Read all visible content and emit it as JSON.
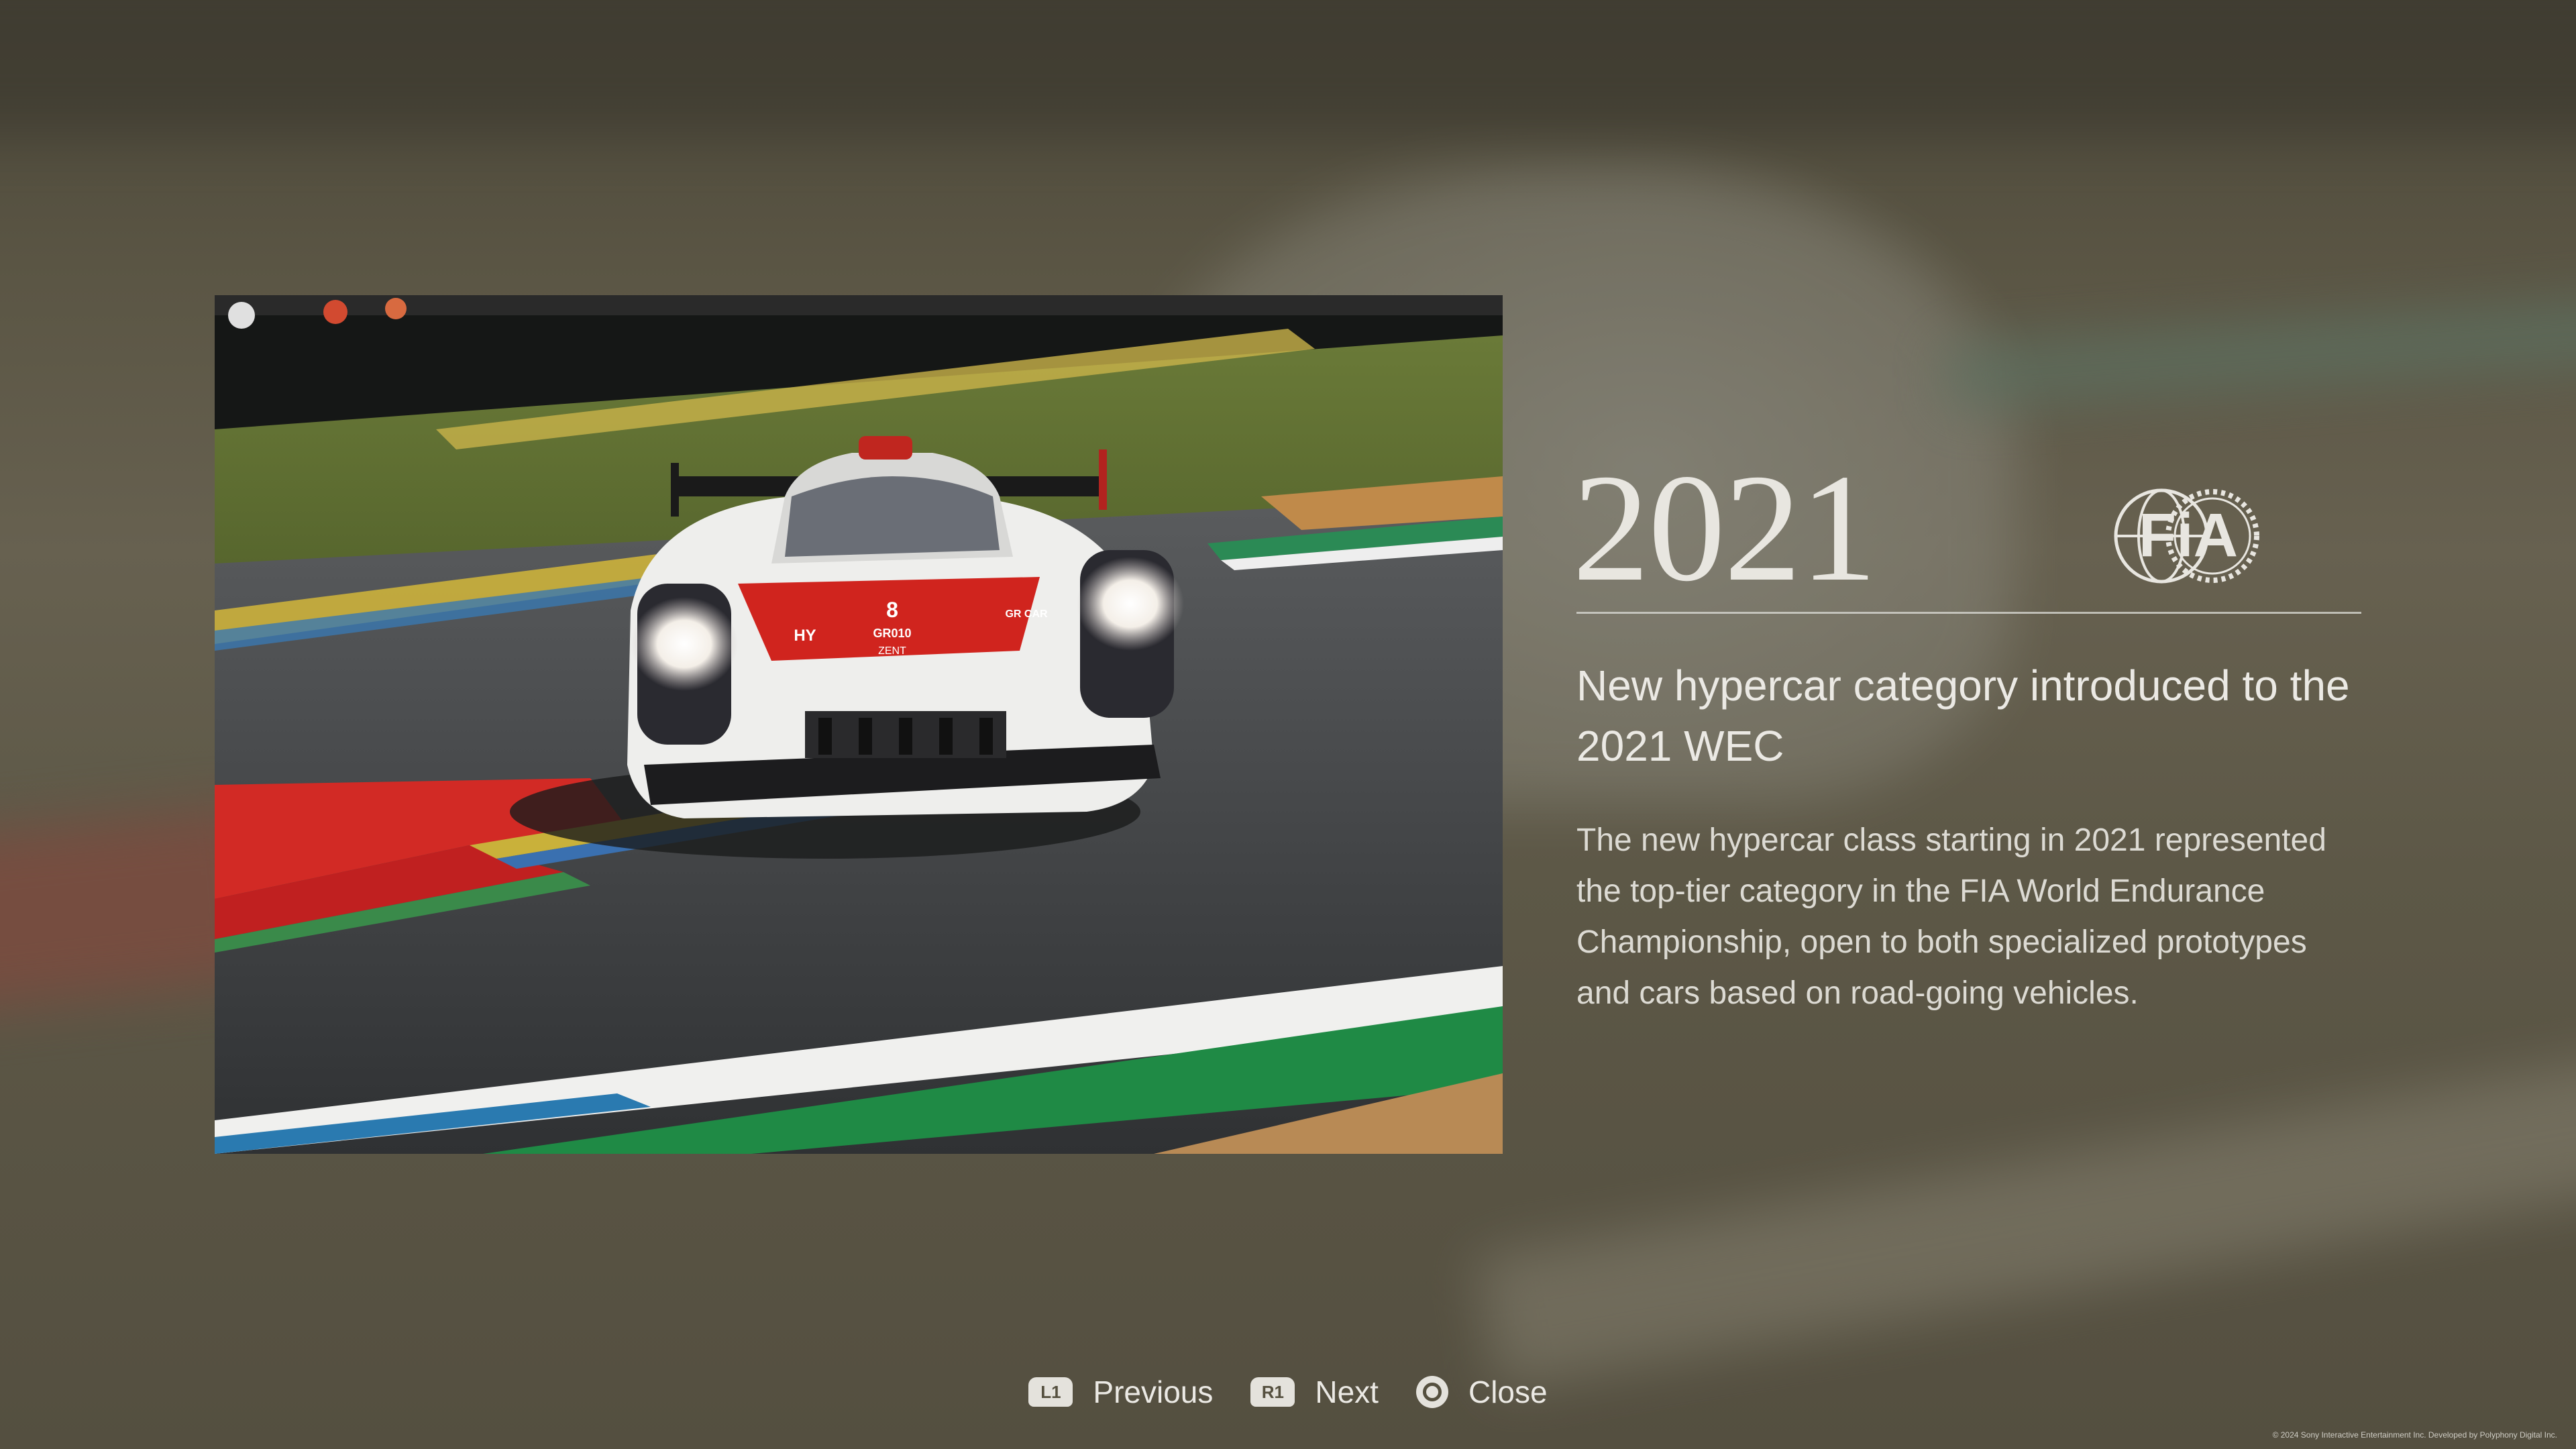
{
  "event": {
    "year": "2021",
    "logo_text": "FiA",
    "headline": "New hypercar category introduced to the 2021 WEC",
    "body": "The new hypercar class starting in 2021 represented the top-tier category in the FIA World Endurance Championship, open to both specialized prototypes and cars based on road-going vehicles.",
    "car_markings": {
      "number": "8",
      "nose_text": "GR010",
      "side_text": "HY",
      "sponsor_text": "ZENT",
      "wing_text": "GR CAR"
    }
  },
  "controls": {
    "previous": {
      "badge": "L1",
      "label": "Previous"
    },
    "next": {
      "badge": "R1",
      "label": "Next"
    },
    "close": {
      "label": "Close"
    }
  },
  "copyright": "© 2024 Sony Interactive Entertainment Inc. Developed by Polyphony Digital Inc.",
  "colors": {
    "background": "#55503f",
    "text_primary": "#ebe9e4",
    "divider": "#dcdcd7"
  }
}
